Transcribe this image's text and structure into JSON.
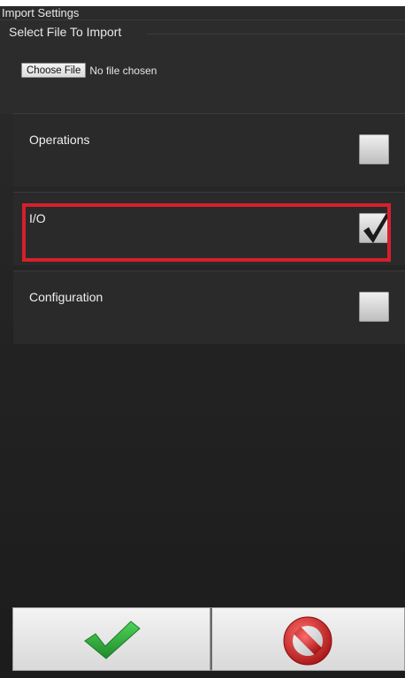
{
  "window": {
    "title": "Import Settings"
  },
  "file_import": {
    "legend": "Select File To Import",
    "choose_button_label": "Choose File",
    "status_text": "No file chosen"
  },
  "sections": [
    {
      "label": "Operations",
      "checked": false
    },
    {
      "label": "I/O",
      "checked": true,
      "highlighted": true
    },
    {
      "label": "Configuration",
      "checked": false
    }
  ],
  "footer": {
    "confirm_icon": "green-checkmark-icon",
    "cancel_icon": "red-no-symbol-icon"
  },
  "colors": {
    "background": "#222222",
    "highlight_border": "#d6202a",
    "confirm_green": "#2fa83a",
    "cancel_red": "#d32a2a"
  }
}
